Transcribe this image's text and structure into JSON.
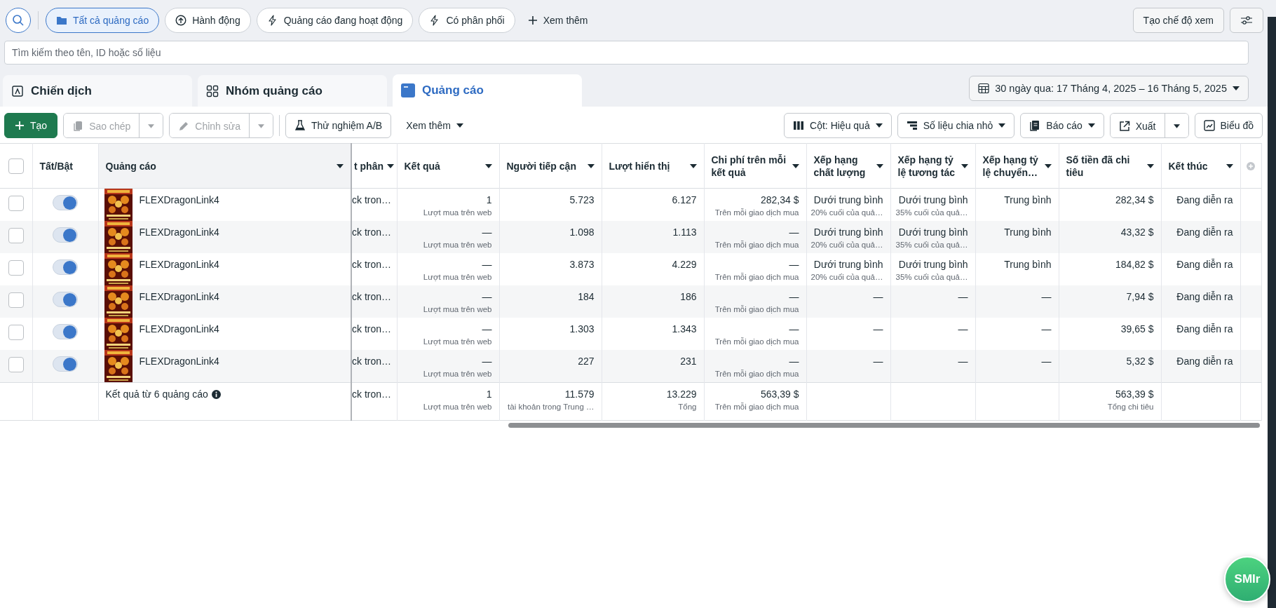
{
  "filters": {
    "chips": [
      {
        "label": "Tất cả quảng cáo",
        "selected": true
      },
      {
        "label": "Hành động",
        "selected": false
      },
      {
        "label": "Quảng cáo đang hoạt động",
        "selected": false
      },
      {
        "label": "Có phân phối",
        "selected": false
      }
    ],
    "more": "Xem thêm",
    "view_button": "Tạo chế độ xem"
  },
  "search": {
    "placeholder": "Tìm kiếm theo tên, ID hoặc số liệu"
  },
  "tabs": [
    {
      "label": "Chiến dịch",
      "selected": false
    },
    {
      "label": "Nhóm quảng cáo",
      "selected": false
    },
    {
      "label": "Quảng cáo",
      "selected": true
    }
  ],
  "date_range": "30 ngày qua: 17 Tháng 4, 2025 – 16 Tháng 5, 2025",
  "toolbar": {
    "left": [
      {
        "kind": "primary",
        "label": "Tạo",
        "disabled": false
      },
      {
        "kind": "split",
        "label": "Sao chép",
        "disabled": true
      },
      {
        "kind": "split",
        "label": "Chỉnh sửa",
        "disabled": true
      },
      {
        "kind": "outline",
        "label": "Thử nghiệm A/B",
        "disabled": false
      },
      {
        "kind": "text",
        "label": "Xem thêm",
        "disabled": false
      }
    ],
    "right": [
      {
        "kind": "dropdown",
        "label": "Cột: Hiệu quả",
        "disabled": false
      },
      {
        "kind": "dropdown",
        "label": "Số liệu chia nhỏ",
        "disabled": false
      },
      {
        "kind": "dropdown",
        "label": "Báo cáo",
        "disabled": false
      },
      {
        "kind": "split",
        "label": "Xuất",
        "disabled": false
      },
      {
        "kind": "outline",
        "label": "Biểu đồ",
        "disabled": false
      }
    ]
  },
  "table": {
    "select_all": {
      "checked": false
    },
    "columns": [
      "",
      "Tất/Bật",
      "Quảng cáo",
      "t phân",
      "Kết quả",
      "Người tiếp cận",
      "Lượt hiển thị",
      "Chi phí trên mỗi kết quả",
      "Xếp hạng chất lượng",
      "Xếp hạng tỷ lệ tương tác",
      "Xếp hạng tỷ lệ chuyển…",
      "Số tiền đã chi tiêu",
      "Kết thúc"
    ],
    "rows": [
      {
        "cells": [
          {
            "kind": "checkbox",
            "checked": false
          },
          {
            "kind": "toggle",
            "on": true
          },
          {
            "kind": "ad",
            "value": "FLEXDragonLink4"
          },
          {
            "kind": "text",
            "value": "ck tron…"
          },
          {
            "kind": "number",
            "value": "1",
            "sub": "Lượt mua trên web"
          },
          {
            "kind": "number",
            "value": "5.723"
          },
          {
            "kind": "number",
            "value": "6.127"
          },
          {
            "kind": "number",
            "value": "282,34 $",
            "sub": "Trên mỗi giao dịch mua"
          },
          {
            "kind": "number",
            "value": "Dưới trung bình",
            "sub": "20% cuối của quả…"
          },
          {
            "kind": "number",
            "value": "Dưới trung bình",
            "sub": "35% cuối của quả…"
          },
          {
            "kind": "number",
            "value": "Trung bình"
          },
          {
            "kind": "number",
            "value": "282,34 $"
          },
          {
            "kind": "number",
            "value": "Đang diễn ra"
          }
        ]
      },
      {
        "cells": [
          {
            "kind": "checkbox",
            "checked": false
          },
          {
            "kind": "toggle",
            "on": true
          },
          {
            "kind": "ad",
            "value": "FLEXDragonLink4"
          },
          {
            "kind": "text",
            "value": "ck tron…"
          },
          {
            "kind": "number",
            "value": "—",
            "sub": "Lượt mua trên web"
          },
          {
            "kind": "number",
            "value": "1.098"
          },
          {
            "kind": "number",
            "value": "1.113"
          },
          {
            "kind": "number",
            "value": "—",
            "sub": "Trên mỗi giao dịch mua"
          },
          {
            "kind": "number",
            "value": "Dưới trung bình",
            "sub": "20% cuối của quả…"
          },
          {
            "kind": "number",
            "value": "Dưới trung bình",
            "sub": "35% cuối của quả…"
          },
          {
            "kind": "number",
            "value": "Trung bình"
          },
          {
            "kind": "number",
            "value": "43,32 $"
          },
          {
            "kind": "number",
            "value": "Đang diễn ra"
          }
        ]
      },
      {
        "cells": [
          {
            "kind": "checkbox",
            "checked": false
          },
          {
            "kind": "toggle",
            "on": true
          },
          {
            "kind": "ad",
            "value": "FLEXDragonLink4"
          },
          {
            "kind": "text",
            "value": "ck tron…"
          },
          {
            "kind": "number",
            "value": "—",
            "sub": "Lượt mua trên web"
          },
          {
            "kind": "number",
            "value": "3.873"
          },
          {
            "kind": "number",
            "value": "4.229"
          },
          {
            "kind": "number",
            "value": "—",
            "sub": "Trên mỗi giao dịch mua"
          },
          {
            "kind": "number",
            "value": "Dưới trung bình",
            "sub": "20% cuối của quả…"
          },
          {
            "kind": "number",
            "value": "Dưới trung bình",
            "sub": "35% cuối của quả…"
          },
          {
            "kind": "number",
            "value": "Trung bình"
          },
          {
            "kind": "number",
            "value": "184,82 $"
          },
          {
            "kind": "number",
            "value": "Đang diễn ra"
          }
        ]
      },
      {
        "cells": [
          {
            "kind": "checkbox",
            "checked": false
          },
          {
            "kind": "toggle",
            "on": true
          },
          {
            "kind": "ad",
            "value": "FLEXDragonLink4"
          },
          {
            "kind": "text",
            "value": "ck tron…"
          },
          {
            "kind": "number",
            "value": "—",
            "sub": "Lượt mua trên web"
          },
          {
            "kind": "number",
            "value": "184"
          },
          {
            "kind": "number",
            "value": "186"
          },
          {
            "kind": "number",
            "value": "—",
            "sub": "Trên mỗi giao dịch mua"
          },
          {
            "kind": "number",
            "value": "—"
          },
          {
            "kind": "number",
            "value": "—"
          },
          {
            "kind": "number",
            "value": "—"
          },
          {
            "kind": "number",
            "value": "7,94 $"
          },
          {
            "kind": "number",
            "value": "Đang diễn ra"
          }
        ]
      },
      {
        "cells": [
          {
            "kind": "checkbox",
            "checked": false
          },
          {
            "kind": "toggle",
            "on": true
          },
          {
            "kind": "ad",
            "value": "FLEXDragonLink4"
          },
          {
            "kind": "text",
            "value": "ck tron…"
          },
          {
            "kind": "number",
            "value": "—",
            "sub": "Lượt mua trên web"
          },
          {
            "kind": "number",
            "value": "1.303"
          },
          {
            "kind": "number",
            "value": "1.343"
          },
          {
            "kind": "number",
            "value": "—",
            "sub": "Trên mỗi giao dịch mua"
          },
          {
            "kind": "number",
            "value": "—"
          },
          {
            "kind": "number",
            "value": "—"
          },
          {
            "kind": "number",
            "value": "—"
          },
          {
            "kind": "number",
            "value": "39,65 $"
          },
          {
            "kind": "number",
            "value": "Đang diễn ra"
          }
        ]
      },
      {
        "cells": [
          {
            "kind": "checkbox",
            "checked": false
          },
          {
            "kind": "toggle",
            "on": true
          },
          {
            "kind": "ad",
            "value": "FLEXDragonLink4"
          },
          {
            "kind": "text",
            "value": "ck tron…"
          },
          {
            "kind": "number",
            "value": "—",
            "sub": "Lượt mua trên web"
          },
          {
            "kind": "number",
            "value": "227"
          },
          {
            "kind": "number",
            "value": "231"
          },
          {
            "kind": "number",
            "value": "—",
            "sub": "Trên mỗi giao dịch mua"
          },
          {
            "kind": "number",
            "value": "—"
          },
          {
            "kind": "number",
            "value": "—"
          },
          {
            "kind": "number",
            "value": "—"
          },
          {
            "kind": "number",
            "value": "5,32 $"
          },
          {
            "kind": "number",
            "value": "Đang diễn ra"
          }
        ]
      }
    ],
    "summary": {
      "cells": [
        null,
        null,
        {
          "kind": "summary",
          "value": "Kết quả từ 6 quảng cáo"
        },
        {
          "kind": "text",
          "value": "ck tron…"
        },
        {
          "kind": "number",
          "value": "1",
          "sub": "Lượt mua trên web"
        },
        {
          "kind": "number",
          "value": "11.579",
          "sub": "tài khoản trong Trung …"
        },
        {
          "kind": "number",
          "value": "13.229",
          "sub": "Tổng"
        },
        {
          "kind": "number",
          "value": "563,39 $",
          "sub": "Trên mỗi giao dịch mua"
        },
        null,
        null,
        null,
        {
          "kind": "number",
          "value": "563,39 $",
          "sub": "Tổng chi tiêu"
        },
        null
      ]
    }
  },
  "fab": "SMIr"
}
